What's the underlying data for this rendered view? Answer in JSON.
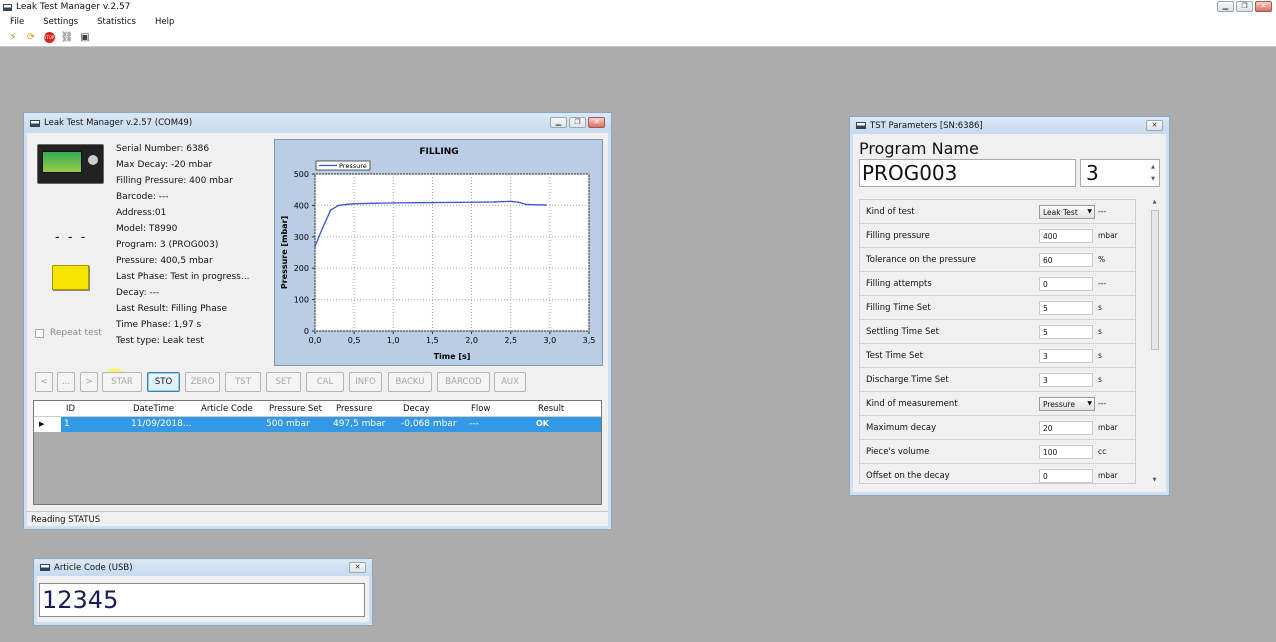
{
  "app": {
    "title": "Leak Test Manager v.2.57",
    "menu": [
      "File",
      "Settings",
      "Statistics",
      "Help"
    ],
    "toolbar_icons": [
      "connect-icon",
      "refresh-icon",
      "stop-icon",
      "link-icon",
      "device-icon"
    ]
  },
  "main_window": {
    "title": "Leak Test Manager v.2.57 (COM49)",
    "info": [
      "Serial Number: 6386",
      "Max Decay: -20 mbar",
      "Filling Pressure: 400 mbar",
      "Barcode: ---",
      "Address:01",
      "Model: T8990",
      "Program: 3 (PROG003)",
      "Pressure: 400,5 mbar",
      "Last Phase: Test in progress...",
      "Decay: ---",
      "Last Result: Filling Phase",
      "Time Phase: 1,97 s",
      "Test type: Leak test"
    ],
    "dash": "- - -",
    "repeat_test_label": "Repeat test",
    "buttons": [
      "<",
      "...",
      ">",
      "STAR",
      "STO",
      "ZERO",
      "TST",
      "SET",
      "CAL",
      "INFO",
      "BACKU",
      "BARCOD",
      "AUX"
    ],
    "table": {
      "headers": [
        "ID",
        "DateTime",
        "Article Code",
        "Pressure Set",
        "Pressure",
        "Decay",
        "Flow",
        "Result"
      ],
      "rows": [
        [
          "1",
          "11/09/2018...",
          "",
          "500 mbar",
          "497,5 mbar",
          "-0,068 mbar",
          "---",
          "OK"
        ]
      ]
    },
    "status": "Reading STATUS"
  },
  "chart_data": {
    "type": "line",
    "title": "FILLING",
    "xlabel": "Time [s]",
    "ylabel": "Pressure [mbar]",
    "xlim": [
      0,
      3.5
    ],
    "ylim": [
      0,
      500
    ],
    "xticks": [
      "0,0",
      "0,5",
      "1,0",
      "1,5",
      "2,0",
      "2,5",
      "3,0",
      "3,5"
    ],
    "yticks": [
      "0",
      "100",
      "200",
      "300",
      "400",
      "500"
    ],
    "grid": true,
    "legend": "top-left",
    "series": [
      {
        "name": "Pressure",
        "color": "#3a55d8",
        "x": [
          0.0,
          0.1,
          0.2,
          0.3,
          0.4,
          0.5,
          0.8,
          1.0,
          1.5,
          2.0,
          2.3,
          2.5,
          2.6,
          2.7,
          2.8,
          2.95
        ],
        "y": [
          270,
          330,
          385,
          400,
          403,
          405,
          407,
          408,
          409,
          410,
          411,
          413,
          410,
          403,
          402,
          401
        ]
      }
    ]
  },
  "article_window": {
    "title": "Article Code (USB)",
    "value": "12345"
  },
  "params_window": {
    "title": "TST Parameters [SN:6386]",
    "program_name_label": "Program Name",
    "program_name": "PROG003",
    "program_number": "3",
    "rows": [
      {
        "label": "Kind of test",
        "value": "Leak Test",
        "unit": "---",
        "select": true
      },
      {
        "label": "Filling pressure",
        "value": "400",
        "unit": "mbar"
      },
      {
        "label": "Tolerance on the pressure",
        "value": "60",
        "unit": "%"
      },
      {
        "label": "Filling attempts",
        "value": "0",
        "unit": "---"
      },
      {
        "label": "Filling Time Set",
        "value": "5",
        "unit": "s"
      },
      {
        "label": "Settling Time Set",
        "value": "5",
        "unit": "s"
      },
      {
        "label": "Test Time Set",
        "value": "3",
        "unit": "s"
      },
      {
        "label": "Discharge Time Set",
        "value": "3",
        "unit": "s"
      },
      {
        "label": "Kind of measurement",
        "value": "Pressure",
        "unit": "---",
        "select": true
      },
      {
        "label": "Maximum decay",
        "value": "20",
        "unit": "mbar"
      },
      {
        "label": "Piece's volume",
        "value": "100",
        "unit": "cc"
      },
      {
        "label": "Offset on the decay",
        "value": "0",
        "unit": "mbar"
      }
    ]
  }
}
